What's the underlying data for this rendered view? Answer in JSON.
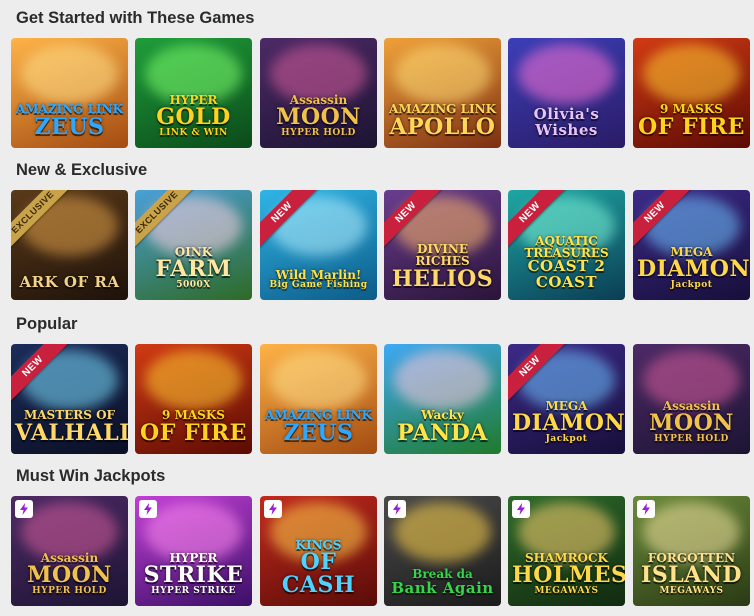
{
  "sections": [
    {
      "title": "Get Started with These Games",
      "games": [
        {
          "l1": "AMAZING LINK",
          "l2": "ZEUS",
          "l3": "",
          "bg": [
            "#ffb347",
            "#a34b12"
          ],
          "glow": "#ffe08a",
          "color": "#2ea8ff"
        },
        {
          "l1": "HYPER",
          "l2": "GOLD",
          "l3": "LINK & WIN",
          "bg": [
            "#1f9d3a",
            "#0b4a1a"
          ],
          "glow": "#7fff6e",
          "color": "#ffd21e"
        },
        {
          "l1": "Assassin",
          "l2": "MOON",
          "l3": "HYPER HOLD",
          "bg": [
            "#4d2a66",
            "#1c1433"
          ],
          "glow": "#d65c9b",
          "color": "#f1c14d"
        },
        {
          "l1": "AMAZING LINK",
          "l2": "APOLLO",
          "l3": "",
          "bg": [
            "#f0a13a",
            "#7c2f12"
          ],
          "glow": "#ffdd77",
          "color": "#ffd55a"
        },
        {
          "l1": "",
          "l2": "Olivia's Wishes",
          "l3": "",
          "bg": [
            "#3b3fb8",
            "#2a1b66"
          ],
          "glow": "#ff73d6",
          "color": "#e7c4ff"
        },
        {
          "l1": "9 MASKS",
          "l2": "OF FIRE",
          "l3": "",
          "bg": [
            "#d23a13",
            "#5a0b04"
          ],
          "glow": "#ffcc33",
          "color": "#ffd21e"
        }
      ]
    },
    {
      "title": "New & Exclusive",
      "games": [
        {
          "l1": "",
          "l2": "ARK OF RA",
          "l3": "",
          "badge": "EXCLUSIVE",
          "badge_style": "gold",
          "bg": [
            "#5a3a1a",
            "#1e120a"
          ],
          "glow": "#e0a04a",
          "color": "#f2d38a"
        },
        {
          "l1": "OINK",
          "l2": "FARM",
          "l3": "5000X",
          "badge": "EXCLUSIVE",
          "badge_style": "gold",
          "bg": [
            "#4aa0d8",
            "#2e6a26"
          ],
          "glow": "#ffd1e3",
          "color": "#ffe8a3"
        },
        {
          "l1": "Wild Marlin!",
          "l2": "",
          "l3": "Big Game Fishing",
          "badge": "NEW",
          "badge_style": "red",
          "bg": [
            "#2fb5e6",
            "#0d5b88"
          ],
          "glow": "#b7f0ff",
          "color": "#ffe14a"
        },
        {
          "l1": "DIVINE RICHES",
          "l2": "HELIOS",
          "l3": "",
          "badge": "NEW",
          "badge_style": "red",
          "bg": [
            "#6a3d8f",
            "#2a1438"
          ],
          "glow": "#ffb86b",
          "color": "#ffd86b"
        },
        {
          "l1": "AQUATIC TREASURES",
          "l2": "COAST 2 COAST",
          "l3": "",
          "badge": "NEW",
          "badge_style": "red",
          "bg": [
            "#1fa7a3",
            "#0b3d55"
          ],
          "glow": "#7ff5d9",
          "color": "#ffe34a"
        },
        {
          "l1": "MEGA",
          "l2": "DIAMONDS",
          "l3": "Jackpot",
          "badge": "NEW",
          "badge_style": "red",
          "bg": [
            "#3c2a88",
            "#170f3a"
          ],
          "glow": "#6ec3ff",
          "color": "#ffd84a"
        }
      ]
    },
    {
      "title": "Popular",
      "games": [
        {
          "l1": "MASTERS OF",
          "l2": "VALHALLA",
          "l3": "",
          "badge": "NEW",
          "badge_style": "red",
          "bg": [
            "#1c2c5a",
            "#0a0f24"
          ],
          "glow": "#7adfff",
          "color": "#ffd86b"
        },
        {
          "l1": "9 MASKS",
          "l2": "OF FIRE",
          "l3": "",
          "bg": [
            "#d23a13",
            "#5a0b04"
          ],
          "glow": "#ffcc33",
          "color": "#ffd21e"
        },
        {
          "l1": "AMAZING LINK",
          "l2": "ZEUS",
          "l3": "",
          "bg": [
            "#ffb347",
            "#a34b12"
          ],
          "glow": "#ffe08a",
          "color": "#2ea8ff"
        },
        {
          "l1": "Wacky",
          "l2": "PANDA",
          "l3": "",
          "bg": [
            "#3fa9f5",
            "#1f7a2a"
          ],
          "glow": "#ffc7de",
          "color": "#ffe44a"
        },
        {
          "l1": "MEGA",
          "l2": "DIAMONDS",
          "l3": "Jackpot",
          "badge": "NEW",
          "badge_style": "red",
          "bg": [
            "#3c2a88",
            "#170f3a"
          ],
          "glow": "#6ec3ff",
          "color": "#ffd84a"
        },
        {
          "l1": "Assassin",
          "l2": "MOON",
          "l3": "HYPER HOLD",
          "bg": [
            "#4d2a66",
            "#1c1433"
          ],
          "glow": "#d65c9b",
          "color": "#f1c14d"
        }
      ]
    },
    {
      "title": "Must Win Jackpots",
      "games": [
        {
          "l1": "Assassin",
          "l2": "MOON",
          "l3": "HYPER HOLD",
          "jackpot": true,
          "bg": [
            "#4d2a66",
            "#1c1433"
          ],
          "glow": "#d65c9b",
          "color": "#f1c14d"
        },
        {
          "l1": "HYPER",
          "l2": "STRIKE",
          "l3": "HYPER STRIKE",
          "jackpot": true,
          "bg": [
            "#c23fd6",
            "#3a0f66"
          ],
          "glow": "#ff8af0",
          "color": "#ffffff"
        },
        {
          "l1": "KINGS",
          "l2": "OF CASH",
          "l3": "",
          "jackpot": true,
          "bg": [
            "#c22a1e",
            "#5a0c08"
          ],
          "glow": "#ffcf4a",
          "color": "#4fd2ff"
        },
        {
          "l1": "Break da",
          "l2": "Bank Again",
          "l3": "",
          "jackpot": true,
          "bg": [
            "#4a4a4a",
            "#1b1b1b"
          ],
          "glow": "#ffd34a",
          "color": "#35d44a"
        },
        {
          "l1": "SHAMROCK",
          "l2": "HOLMES",
          "l3": "MEGAWAYS",
          "jackpot": true,
          "bg": [
            "#2d6b2a",
            "#112a10"
          ],
          "glow": "#ffd070",
          "color": "#ffd84a"
        },
        {
          "l1": "FORGOTTEN",
          "l2": "ISLAND",
          "l3": "MEGAWAYS",
          "jackpot": true,
          "bg": [
            "#6a8a3a",
            "#2a3a14"
          ],
          "glow": "#f4e3a0",
          "color": "#ffe28a"
        }
      ]
    }
  ],
  "icons": {
    "jackpot": "lightning-bolt-icon"
  },
  "colors": {
    "page_bg": "#ededed",
    "new_ribbon": "#c9213d",
    "exclusive_ribbon": "#c9a34a",
    "jackpot_bolt": "#9a1fd6"
  }
}
